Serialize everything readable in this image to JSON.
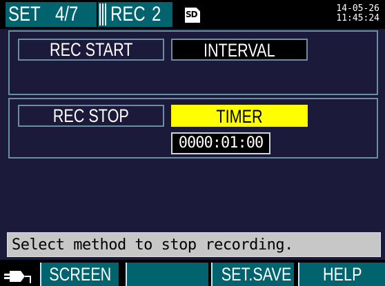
{
  "header": {
    "tab_set": {
      "label": "SET",
      "page": "4/7"
    },
    "tab_rec": {
      "label": "REC",
      "number": "2"
    },
    "sd_icon": "sd-card-icon",
    "sd_label": "SD",
    "date": "14-05-26",
    "time": "11:45:24"
  },
  "rec_start": {
    "label": "REC START",
    "value": "INTERVAL"
  },
  "rec_stop": {
    "label": "REC STOP",
    "value": "TIMER",
    "timer": "0000:01:00"
  },
  "help": {
    "text": "Select method to stop recording."
  },
  "footer": {
    "power_icon": "power-plug-icon",
    "keys": [
      "SCREEN",
      "",
      "SET.SAVE",
      "HELP"
    ]
  },
  "colors": {
    "background": "#1b1a3a",
    "tab": "#00636e",
    "selected": "#ffff00",
    "border": "#6a8fa3"
  }
}
